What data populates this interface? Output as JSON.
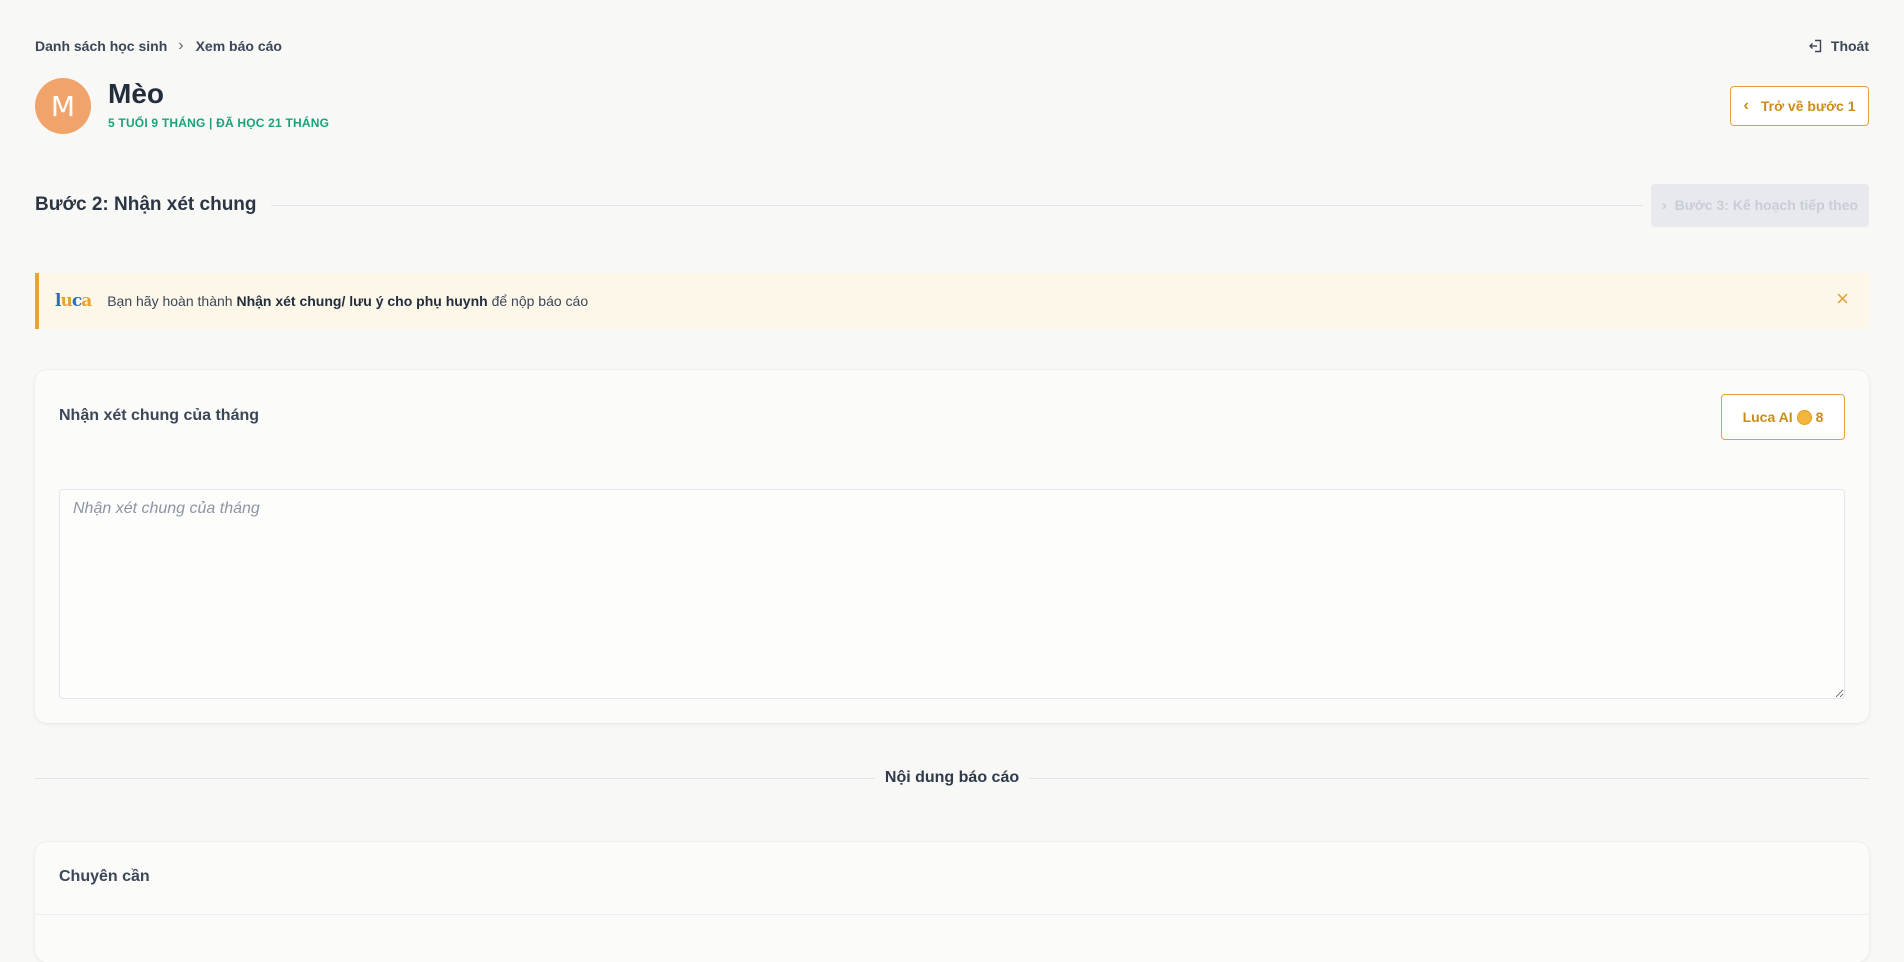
{
  "breadcrumb": {
    "items": [
      "Danh sách học sinh",
      "Xem báo cáo"
    ],
    "separator": "›"
  },
  "header": {
    "logout_label": "Thoát",
    "back_button_label": "Trở về bước 1"
  },
  "student": {
    "initial": "M",
    "name": "Mèo",
    "meta": "5 TUỔI 9 THÁNG | ĐÃ HỌC 21 THÁNG",
    "avatar_color": "#f0a46b"
  },
  "step": {
    "title": "Bước 2: Nhận xét chung",
    "next_button_label": "Bước 3: Kế hoạch tiếp theo"
  },
  "notice": {
    "prefix": "Bạn hãy hoàn thành ",
    "bold": "Nhận xét chung/ lưu ý cho phụ huynh",
    "suffix": " để nộp báo cáo",
    "close_icon": "×"
  },
  "comment_card": {
    "title": "Nhận xét chung của tháng",
    "ai_button_label": "Luca AI",
    "ai_credits": "8",
    "placeholder": "Nhận xét chung của tháng"
  },
  "section": {
    "label": "Nội dung báo cáo"
  },
  "attendance_card": {
    "title": "Chuyên cần"
  },
  "colors": {
    "accent": "#e0a33c",
    "meta_green": "#1aa37a",
    "notice_bg": "#fdf7ea"
  }
}
